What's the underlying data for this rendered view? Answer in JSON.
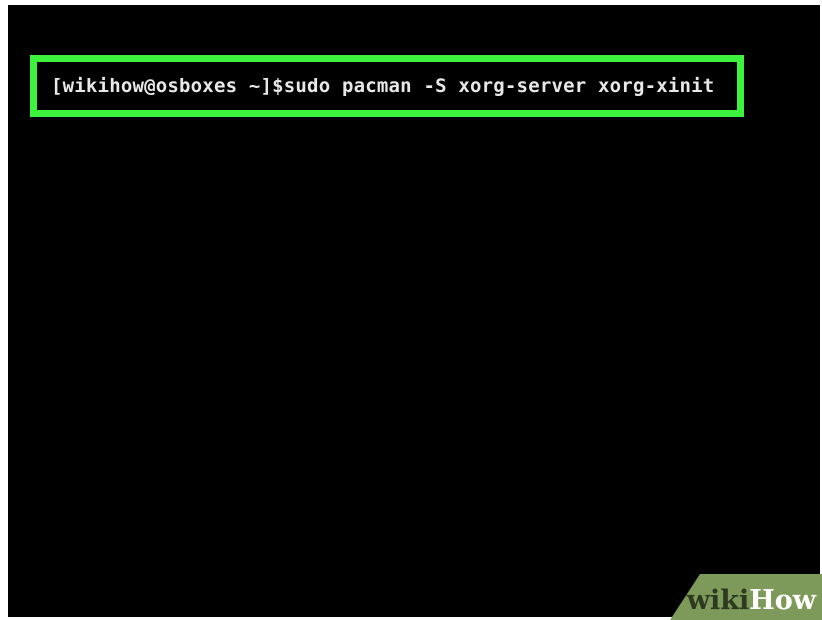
{
  "terminal": {
    "prompt": "[wikihow@osboxes ~]$",
    "command": "sudo pacman -S xorg-server xorg-xinit"
  },
  "highlight": {
    "color": "#3df23d"
  },
  "watermark": {
    "part1": "wiki",
    "part2": "How",
    "background": "#7d9a5a"
  }
}
